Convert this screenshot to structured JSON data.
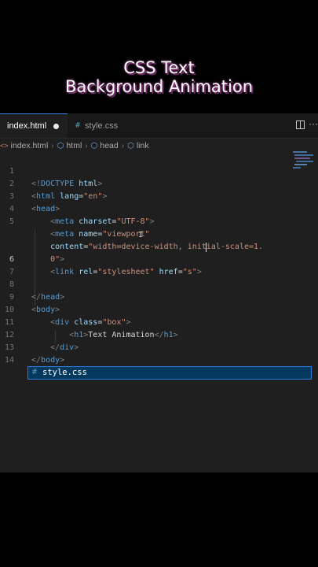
{
  "title": {
    "line1": "CSS Text",
    "line2": "Background Animation"
  },
  "tabs": [
    {
      "label": "index.html",
      "modified": true,
      "active": true
    },
    {
      "label": "style.css",
      "icon": "#",
      "active": false
    }
  ],
  "breadcrumb": {
    "file": "index.html",
    "items": [
      "html",
      "head",
      "link"
    ]
  },
  "line_numbers": [
    "1",
    "2",
    "3",
    "4",
    "5",
    "",
    "6",
    "7",
    "8",
    "9",
    "10",
    "11",
    "12",
    "13",
    "14"
  ],
  "suggestion": {
    "icon": "#",
    "label": "style.css"
  },
  "colors": {
    "keyword": "#569cd6",
    "attribute": "#9cdcfe",
    "string": "#ce9178",
    "selection": "#04395e",
    "background": "#1f1f1f"
  }
}
